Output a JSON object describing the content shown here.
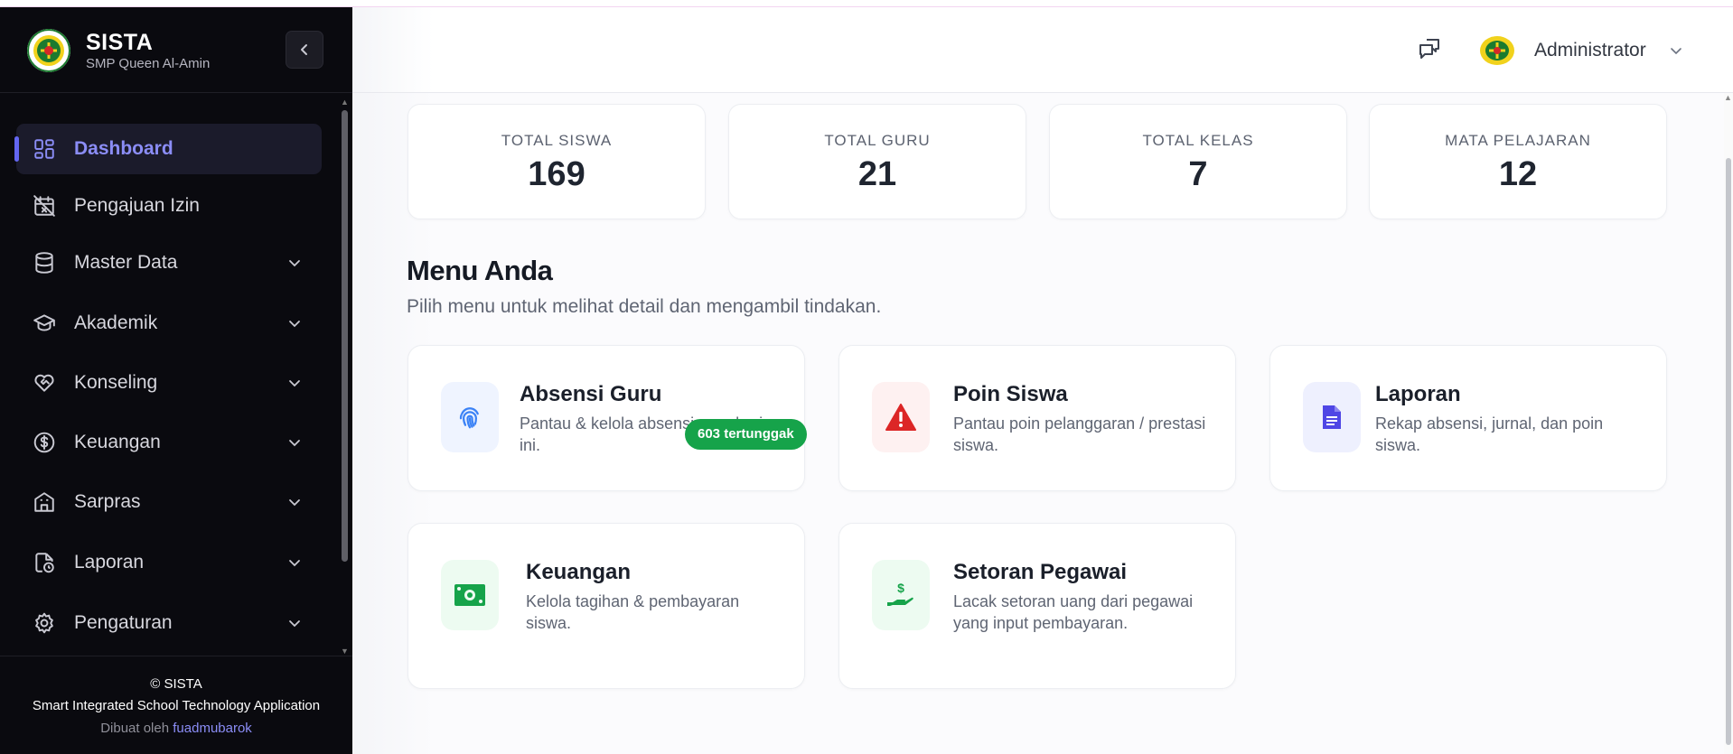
{
  "brand": {
    "title": "SISTA",
    "subtitle": "SMP Queen Al-Amin"
  },
  "sidebar": {
    "items": [
      {
        "label": "Dashboard",
        "icon": "dashboard-grid-icon",
        "active": true,
        "has_submenu": false
      },
      {
        "label": "Pengajuan Izin",
        "icon": "calendar-x-icon",
        "active": false,
        "has_submenu": false
      },
      {
        "label": "Master Data",
        "icon": "database-icon",
        "active": false,
        "has_submenu": true
      },
      {
        "label": "Akademik",
        "icon": "graduation-cap-icon",
        "active": false,
        "has_submenu": true
      },
      {
        "label": "Konseling",
        "icon": "heart-handshake-icon",
        "active": false,
        "has_submenu": true
      },
      {
        "label": "Keuangan",
        "icon": "dollar-circle-icon",
        "active": false,
        "has_submenu": true
      },
      {
        "label": "Sarpras",
        "icon": "building-icon",
        "active": false,
        "has_submenu": true
      },
      {
        "label": "Laporan",
        "icon": "file-clock-icon",
        "active": false,
        "has_submenu": true
      },
      {
        "label": "Pengaturan",
        "icon": "gear-icon",
        "active": false,
        "has_submenu": true
      }
    ],
    "footer": {
      "copyright": "© SISTA",
      "full_name": "Smart Integrated School Technology Application",
      "made_by_prefix": "Dibuat oleh",
      "made_by_name": "fuadmubarok"
    }
  },
  "header": {
    "user_name": "Administrator"
  },
  "stats": [
    {
      "label": "TOTAL SISWA",
      "value": "169"
    },
    {
      "label": "TOTAL GURU",
      "value": "21"
    },
    {
      "label": "TOTAL KELAS",
      "value": "7"
    },
    {
      "label": "MATA PELAJARAN",
      "value": "12"
    }
  ],
  "menu": {
    "title": "Menu Anda",
    "subtitle": "Pilih menu untuk melihat detail dan mengambil tindakan.",
    "cards": [
      {
        "title": "Absensi Guru",
        "desc": "Pantau & kelola absensi guru hari ini.",
        "icon": "fingerprint-icon",
        "icon_color": "#3b82f6",
        "icon_bg": "#eff4ff"
      },
      {
        "title": "Poin Siswa",
        "desc": "Pantau poin pelanggaran / prestasi siswa.",
        "icon": "warning-triangle-icon",
        "icon_color": "#dc2626",
        "icon_bg": "#fef1f1"
      },
      {
        "title": "Laporan",
        "desc": "Rekap absensi, jurnal, dan poin siswa.",
        "icon": "document-icon",
        "icon_color": "#4f46e5",
        "icon_bg": "#eef0fe"
      },
      {
        "title": "Keuangan",
        "desc": "Kelola tagihan & pembayaran siswa.",
        "icon": "money-bill-icon",
        "icon_color": "#16a34a",
        "icon_bg": "#edfbf1",
        "badge": "603 tertunggak"
      },
      {
        "title": "Setoran Pegawai",
        "desc": "Lacak setoran uang dari pegawai yang input pembayaran.",
        "icon": "hand-dollar-icon",
        "icon_color": "#16a34a",
        "icon_bg": "#edfbf1"
      }
    ]
  },
  "colors": {
    "accent": "#6366f1",
    "sidebar_bg": "#0a0a0f",
    "badge_green": "#16a34a"
  }
}
